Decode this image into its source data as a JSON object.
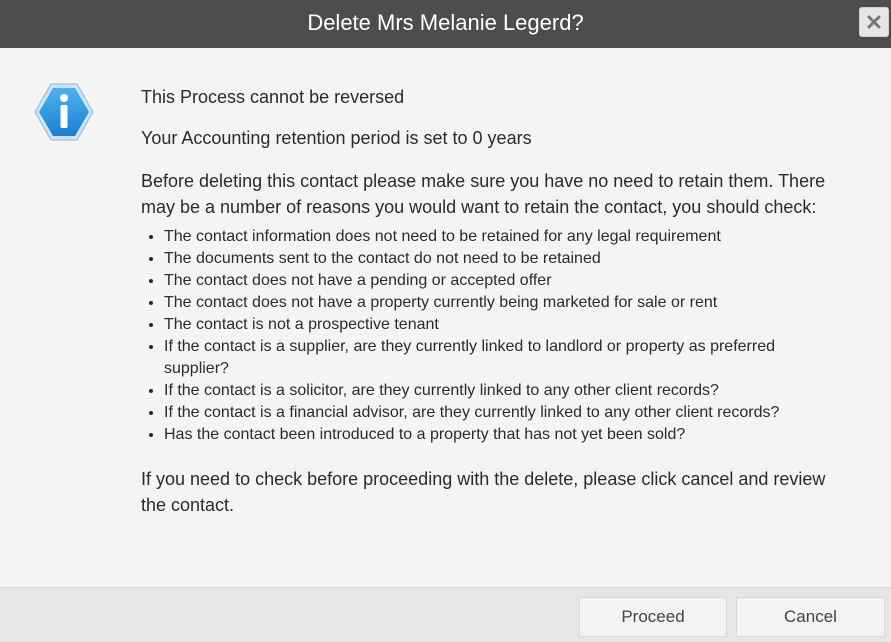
{
  "dialog": {
    "title": "Delete Mrs Melanie Legerd?",
    "close_icon": "close-icon",
    "info_icon": "info-icon",
    "accent_color": "#2a8fd8",
    "titlebar_color": "#4d4d4d"
  },
  "content": {
    "line1": "This Process cannot be reversed",
    "line2": "Your Accounting retention period is set to 0 years",
    "intro": "Before deleting this contact please make sure you have no need to retain them. There may be a number of reasons you would want to retain the contact, you should check:",
    "checks": [
      "The contact information does not need to be retained for any legal requirement",
      "The documents sent to the contact do not need to be retained",
      "The contact does not have a pending or accepted offer",
      "The contact does not have a property currently being marketed for sale or rent",
      "The contact is not a prospective tenant",
      "If the contact is a supplier, are they currently linked to landlord or property as preferred supplier?",
      "If the contact is a solicitor, are they currently linked to any other client records?",
      "If the contact is a financial advisor, are they currently linked to any other client records?",
      "Has the contact been introduced to a property that has not yet been sold?"
    ],
    "closing": "If you need to check before proceeding with the delete, please click cancel and review the contact."
  },
  "footer": {
    "proceed_label": "Proceed",
    "cancel_label": "Cancel"
  }
}
